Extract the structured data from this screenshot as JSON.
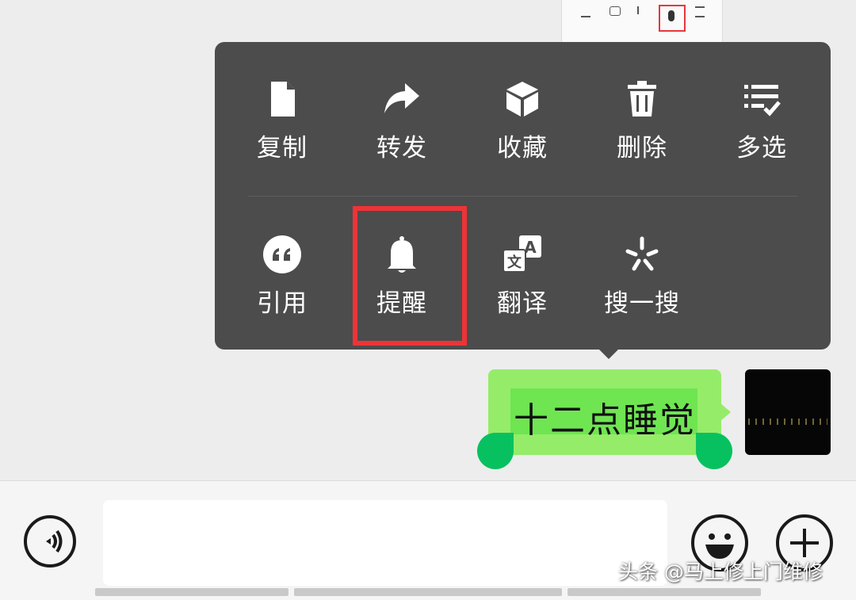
{
  "context_menu": {
    "row1": [
      {
        "label": "复制",
        "icon": "document-icon"
      },
      {
        "label": "转发",
        "icon": "forward-arrow-icon"
      },
      {
        "label": "收藏",
        "icon": "cube-icon"
      },
      {
        "label": "删除",
        "icon": "trash-icon"
      },
      {
        "label": "多选",
        "icon": "checklist-icon"
      }
    ],
    "row2": [
      {
        "label": "引用",
        "icon": "quote-icon"
      },
      {
        "label": "提醒",
        "icon": "bell-icon"
      },
      {
        "label": "翻译",
        "icon": "translate-icon"
      },
      {
        "label": "搜一搜",
        "icon": "search-sparkle-icon"
      }
    ],
    "highlighted_item": "提醒"
  },
  "message": {
    "text": "十二点睡觉",
    "bubble_color": "#95ec69"
  },
  "input_bar": {
    "voice_icon": "voice-icon",
    "emoji_icon": "emoji-icon",
    "plus_icon": "plus-icon"
  },
  "watermark": "头条 @马上修上门维修",
  "colors": {
    "menu_bg": "#4c4c4c",
    "highlight_border": "#ee3337",
    "handle": "#07c160"
  }
}
